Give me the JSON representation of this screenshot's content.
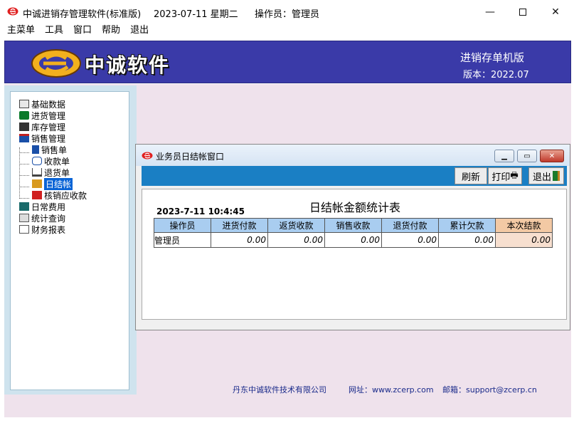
{
  "window": {
    "app_title": "中诚进销存管理软件(标准版)",
    "date": "2023-07-11  星期二",
    "operator": "操作员：管理员"
  },
  "menu": [
    "主菜单",
    "工具",
    "窗口",
    "帮助",
    "退出"
  ],
  "banner": {
    "brand": "中诚软件",
    "edition": "进销存单机版",
    "version": "版本：2022.07"
  },
  "nav": {
    "items": [
      {
        "label": "基础数据",
        "icon": "book-icon"
      },
      {
        "label": "进货管理",
        "icon": "truck-icon"
      },
      {
        "label": "库存管理",
        "icon": "warehouse-icon"
      },
      {
        "label": "销售管理",
        "icon": "shop-icon"
      },
      {
        "label": "销售单",
        "icon": "receipt-icon"
      },
      {
        "label": "收款单",
        "icon": "hand-icon"
      },
      {
        "label": "退货单",
        "icon": "return-icon"
      },
      {
        "label": "日结帐",
        "icon": "ledger-icon"
      },
      {
        "label": "核销应收款",
        "icon": "check-icon"
      },
      {
        "label": "日常费用",
        "icon": "calculator-icon"
      },
      {
        "label": "统计查询",
        "icon": "chart-icon"
      },
      {
        "label": "财务报表",
        "icon": "report-icon"
      }
    ]
  },
  "footer": {
    "company": "丹东中诚软件技术有限公司",
    "website": "网址：www.zcerp.com",
    "email": "邮箱：support@zcerp.cn"
  },
  "child_window": {
    "title": "业务员日结帐窗口",
    "toolbar": {
      "refresh": "刷新",
      "print": "打印",
      "exit": "退出"
    },
    "report_title": "日结帐金额统计表",
    "report_time": "2023-7-11  10:4:45",
    "columns": [
      "操作员",
      "进货付款",
      "返货收款",
      "销售收款",
      "退货付款",
      "累计欠款",
      "本次结款"
    ],
    "rows": [
      [
        "管理员",
        "0.00",
        "0.00",
        "0.00",
        "0.00",
        "0.00",
        "0.00"
      ]
    ]
  }
}
